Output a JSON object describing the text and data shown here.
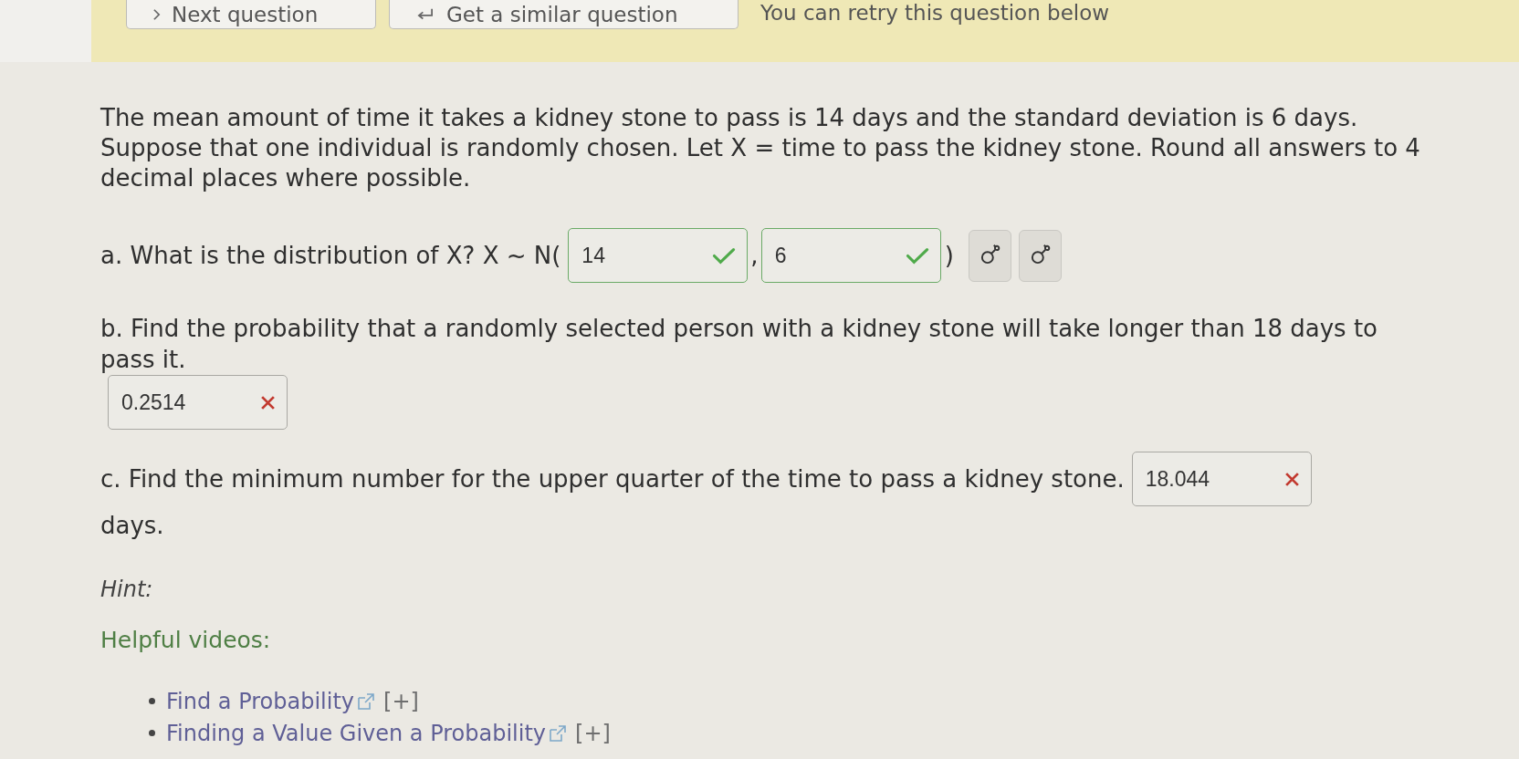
{
  "toolbar": {
    "buttons": [
      {
        "kind": "next",
        "label": "Next question"
      },
      {
        "kind": "similar",
        "label": "Get a similar question"
      }
    ],
    "note": "You can retry this question below"
  },
  "question": {
    "text": "The mean amount of time it takes a kidney stone to pass is 14 days and the standard deviation is 6 days. Suppose that one individual is randomly chosen. Let X = time to pass the kidney stone. Round all answers to 4 decimal places where possible.",
    "parts": [
      {
        "prompt": "a. What is the distribution of X? X ~ N(",
        "answers": [
          {
            "value": "14",
            "correct": true
          },
          {
            "value": "6",
            "correct": true
          }
        ],
        "separator": ",",
        "closing": ")",
        "buttons": [
          {
            "kind": "symbol"
          },
          {
            "kind": "symbol"
          }
        ]
      },
      {
        "prompt": "b. Find the probability that a randomly selected person with a kidney stone will take longer than 18 days to pass it.",
        "answers": [
          {
            "value": "0.2514",
            "correct": false
          }
        ]
      },
      {
        "prompt": "c. Find the minimum number for the upper quarter of the time to pass a kidney stone.",
        "answers": [
          {
            "value": "18.044",
            "correct": false
          }
        ],
        "suffix": "days."
      }
    ]
  },
  "hint": {
    "label": "Hint:"
  },
  "helpful_videos": {
    "title": "Helpful videos:",
    "links": [
      {
        "label": "Find a Probability",
        "expand": "[+]"
      },
      {
        "label": "Finding a Value Given a Probability",
        "expand": "[+]"
      }
    ]
  }
}
